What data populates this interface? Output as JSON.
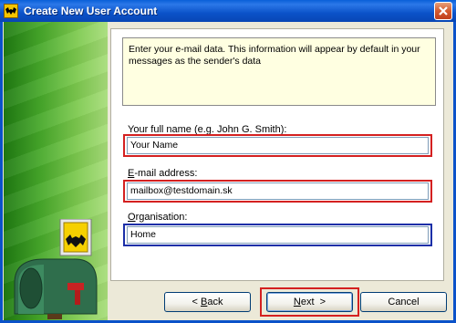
{
  "window": {
    "title": "Create New User Account"
  },
  "info_text": "Enter your e-mail data. This information will appear by default in your messages as the sender's data",
  "fields": {
    "full_name": {
      "label": "Your full name (e.g. John G. Smith):",
      "value": "Your Name"
    },
    "email": {
      "label_accel": "E",
      "label_rest": "-mail address:",
      "value": "mailbox@testdomain.sk"
    },
    "organisation": {
      "label_accel": "O",
      "label_rest": "rganisation:",
      "value": "Home"
    }
  },
  "buttons": {
    "back": {
      "prefix": "< ",
      "accel": "B",
      "rest": "ack"
    },
    "next": {
      "accel": "N",
      "rest": "ext  >"
    },
    "cancel": "Cancel"
  },
  "highlight_colors": {
    "red": "#d42020",
    "blue": "#1b2fa8"
  },
  "icons": [
    "app-bat-icon",
    "close-icon",
    "mailbox-illustration"
  ]
}
